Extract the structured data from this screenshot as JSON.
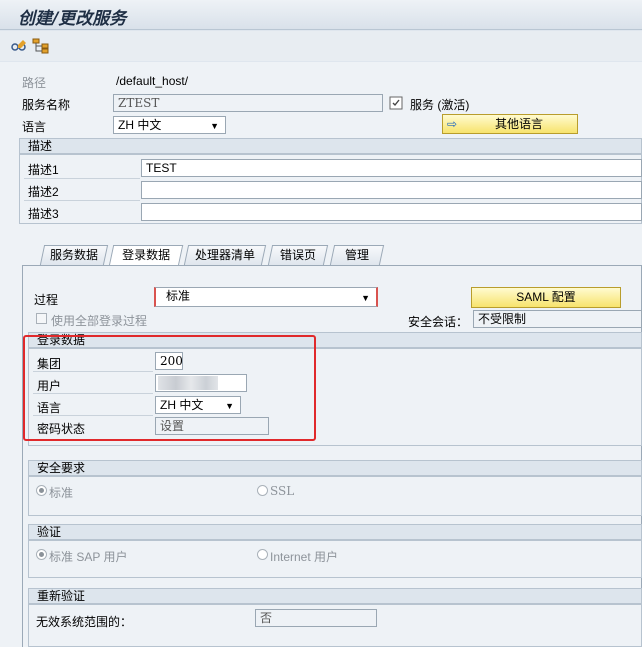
{
  "window": {
    "title": "创建/更改服务"
  },
  "toolbar": {
    "icon1": "glasses-pencil-icon",
    "icon2": "hierarchy-icon"
  },
  "header": {
    "path_label": "路径",
    "path_value": "/default_host/",
    "service_name_label": "服务名称",
    "service_name_value": "ZTEST",
    "service_status_icon": "service-status-icon",
    "service_status": "服务 (激活)",
    "language_label": "语言",
    "language_value": "ZH 中文",
    "other_lang_button": "其他语言"
  },
  "description": {
    "title": "描述",
    "rows": [
      {
        "label": "描述1",
        "value": "TEST"
      },
      {
        "label": "描述2",
        "value": ""
      },
      {
        "label": "描述3",
        "value": ""
      }
    ]
  },
  "tabs": [
    {
      "label": "服务数据"
    },
    {
      "label": "登录数据"
    },
    {
      "label": "处理器清单"
    },
    {
      "label": "错误页"
    },
    {
      "label": "管理"
    }
  ],
  "active_tab": "登录数据",
  "logon": {
    "procedure_label": "过程",
    "procedure_value": "标准",
    "saml_button": "SAML 配置",
    "use_all_label": "使用全部登录过程",
    "security_session_label": "安全会话：",
    "security_session_value": "不受限制",
    "login_data_title": "登录数据",
    "client_label": "集团",
    "client_value": "200",
    "user_label": "用户",
    "lang_label": "语言",
    "lang_value": "ZH 中文",
    "password_label": "密码状态",
    "password_value": "设置"
  },
  "security": {
    "title": "安全要求",
    "opt_standard": "标准",
    "opt_ssl": "SSL"
  },
  "auth": {
    "title": "验证",
    "opt_sap": "标准 SAP 用户",
    "opt_internet": "Internet 用户"
  },
  "reauth": {
    "title": "重新验证",
    "label": "无效系统范围的：",
    "value": "否"
  },
  "colors": {
    "highlight": "#e0292b",
    "button": "#f7e36d"
  }
}
